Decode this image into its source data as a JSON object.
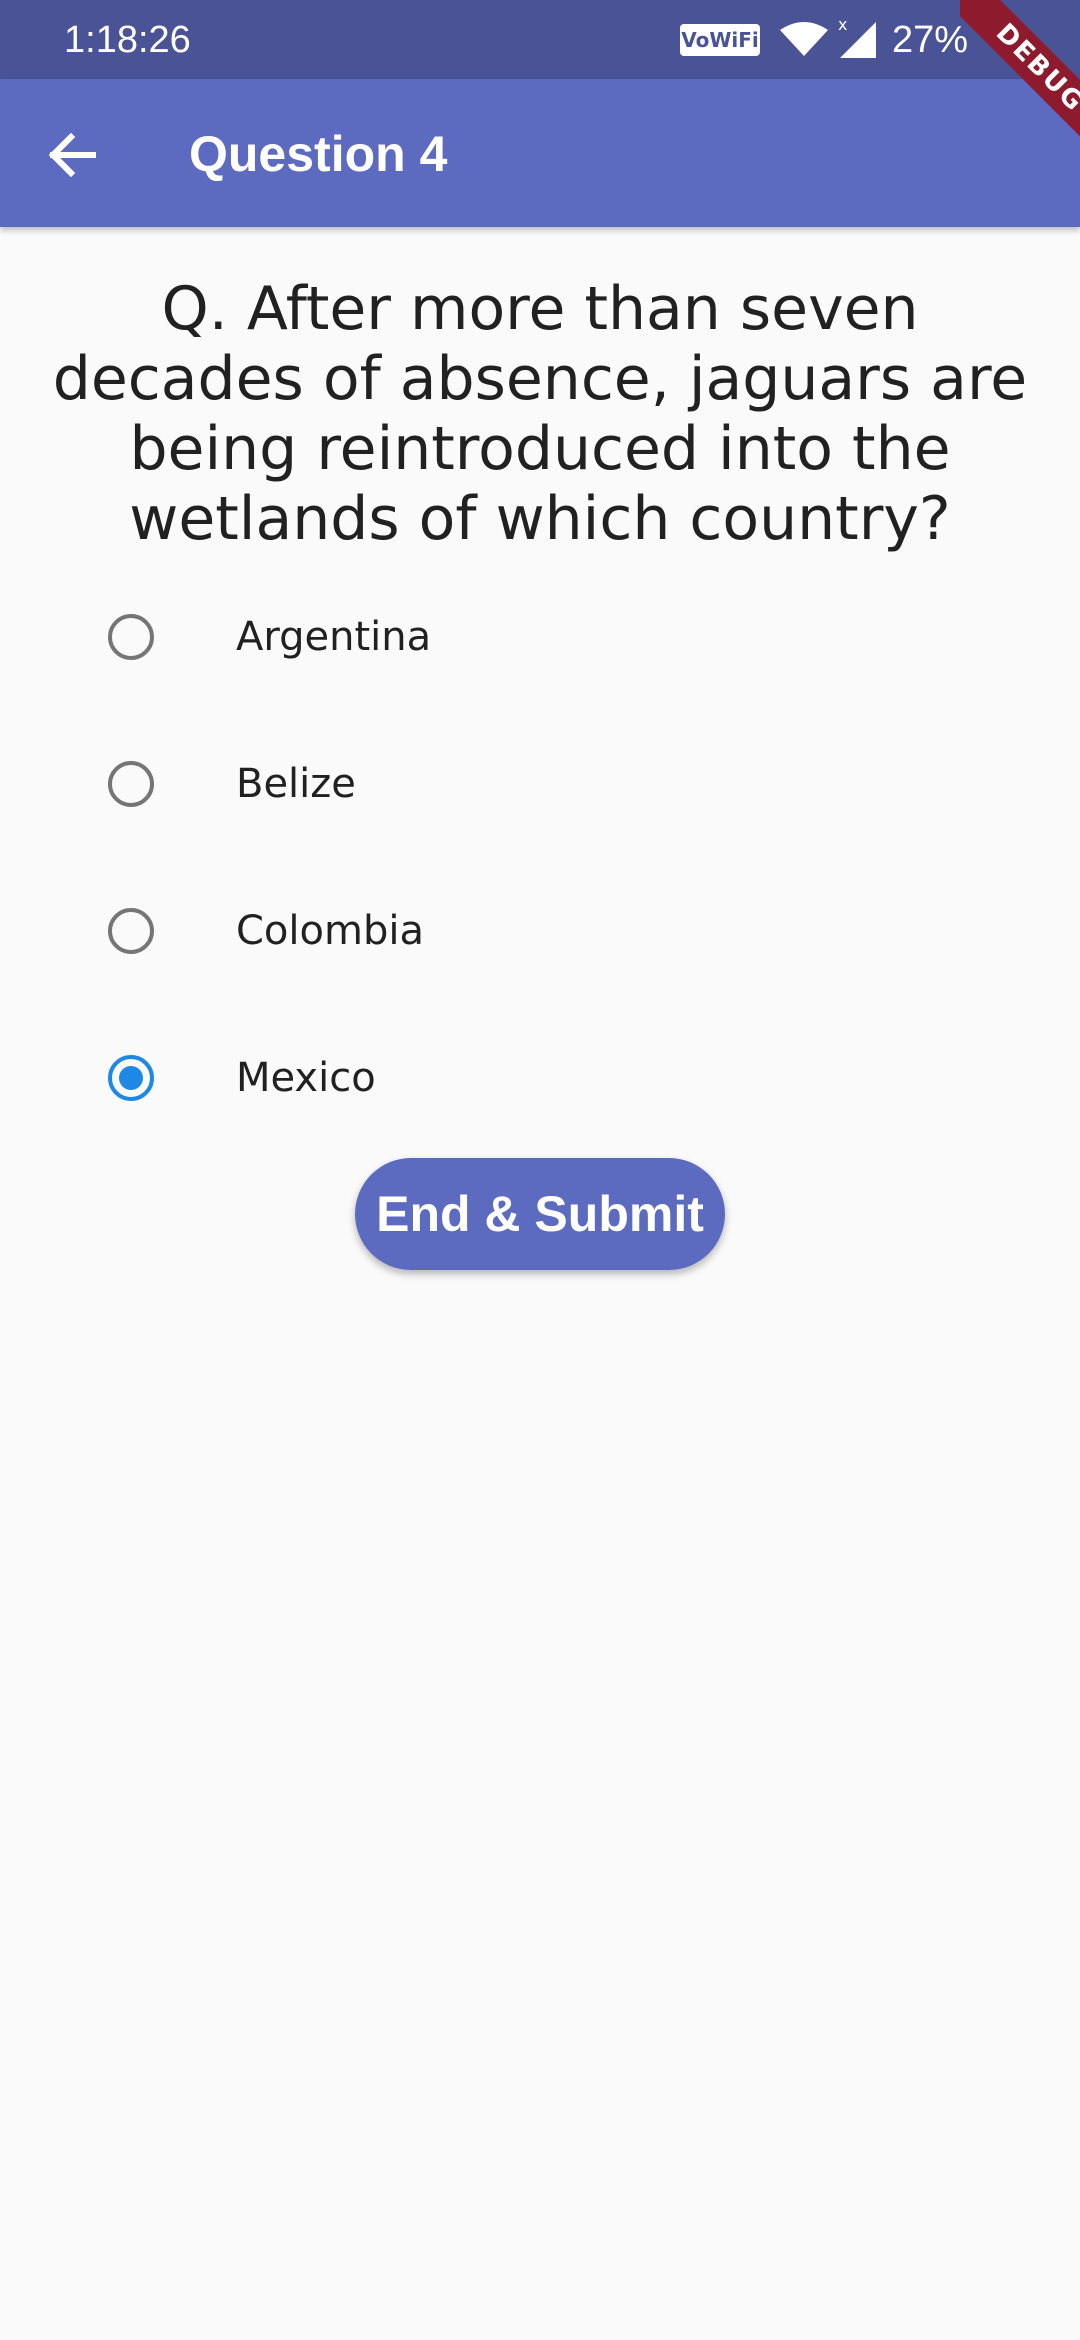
{
  "status_bar": {
    "time": "1:18:26",
    "vowifi_label": "VoWiFi",
    "battery_percent": "27%",
    "icons": [
      "vowifi-icon",
      "wifi-icon",
      "signal-icon"
    ]
  },
  "app_bar": {
    "title": "Question 4",
    "back_icon": "arrow-back-icon",
    "background_color": "#5c6bc0"
  },
  "debug_banner": {
    "label": "DEBUG",
    "color": "#8e1a2e"
  },
  "question": {
    "text": "Q. After more than seven decades of absence, jaguars are being reintroduced into the wetlands of which country?"
  },
  "options": [
    {
      "label": "Argentina",
      "selected": false
    },
    {
      "label": "Belize",
      "selected": false
    },
    {
      "label": "Colombia",
      "selected": false
    },
    {
      "label": "Mexico",
      "selected": true
    }
  ],
  "submit_button": {
    "label": "End & Submit",
    "color": "#5c6bc0"
  },
  "colors": {
    "accent": "#1e88e5",
    "status_bar": "#4a5396",
    "background": "#fafafa"
  }
}
